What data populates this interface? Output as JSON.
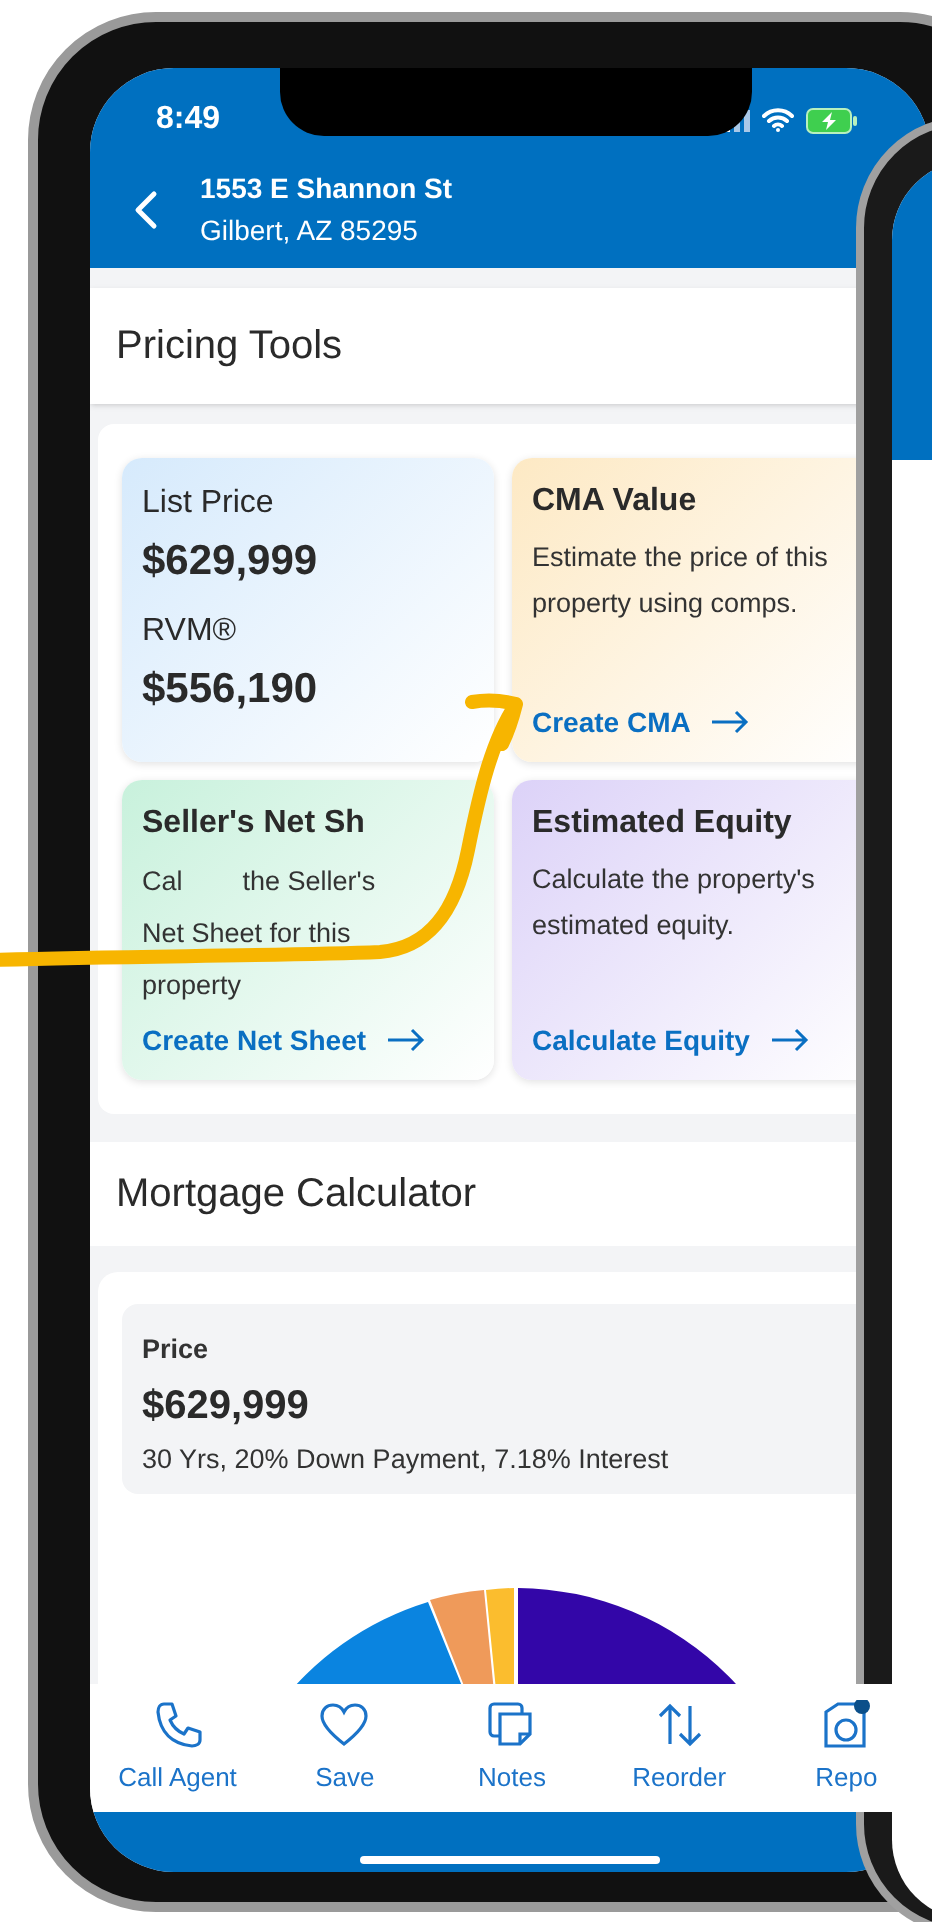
{
  "status_bar": {
    "time": "8:49"
  },
  "header": {
    "title": "1553 E Shannon St",
    "subtitle": "Gilbert, AZ 85295"
  },
  "pricing_tools": {
    "title": "Pricing Tools",
    "cards": [
      {
        "kind": "price",
        "color": "#d6eafc",
        "items": [
          {
            "label": "List Price",
            "value": "$629,999"
          },
          {
            "label": "RVM®",
            "value": "$556,190"
          }
        ]
      },
      {
        "kind": "tool",
        "color": "#fde9c4",
        "title": "CMA Value",
        "description": [
          "Estimate the price of this property using comps."
        ],
        "link": "Create CMA"
      },
      {
        "kind": "tool",
        "color": "#c8f1dc",
        "title": "Seller's Net Sh",
        "description": [
          "Cal",
          "the Seller's",
          "Net Sheet for this property"
        ],
        "link": "Create Net Sheet"
      },
      {
        "kind": "tool",
        "color": "#dcd2f8",
        "title": "Estimated Equity",
        "description": [
          "Calculate the property's estimated equity."
        ],
        "link": "Calculate Equity"
      }
    ]
  },
  "mortgage_calculator": {
    "title": "Mortgage Calculator",
    "price_label": "Price",
    "price": "$629,999",
    "terms": "30 Yrs, 20% Down Payment, 7.18% Interest"
  },
  "bottom_nav": [
    {
      "label": "Call Agent"
    },
    {
      "label": "Save"
    },
    {
      "label": "Notes"
    },
    {
      "label": "Reorder"
    },
    {
      "label": "Repo"
    }
  ]
}
